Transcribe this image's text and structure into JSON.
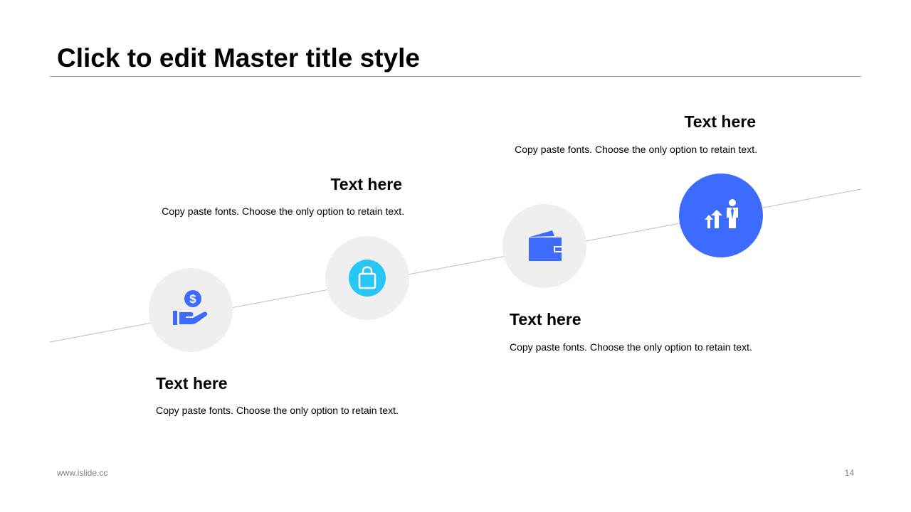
{
  "slide": {
    "title": "Click to edit Master title style"
  },
  "steps": [
    {
      "heading": "Text here",
      "description": "Copy paste fonts. Choose the only option to retain text.",
      "icon": "money-hand-icon"
    },
    {
      "heading": "Text here",
      "description": "Copy paste fonts. Choose the only option to retain text.",
      "icon": "shopping-bag-icon"
    },
    {
      "heading": "Text here",
      "description": "Copy paste fonts. Choose the only option to retain text.",
      "icon": "wallet-icon"
    },
    {
      "heading": "Text here",
      "description": "Copy paste fonts. Choose the only option to retain text.",
      "icon": "growth-businessman-icon"
    }
  ],
  "footer": {
    "url": "www.islide.cc",
    "page_number": "14"
  },
  "colors": {
    "accent_blue": "#3d6bff",
    "accent_cyan": "#27c6f5",
    "node_gray": "#efefef",
    "rule_gray": "#a6a6a6"
  }
}
